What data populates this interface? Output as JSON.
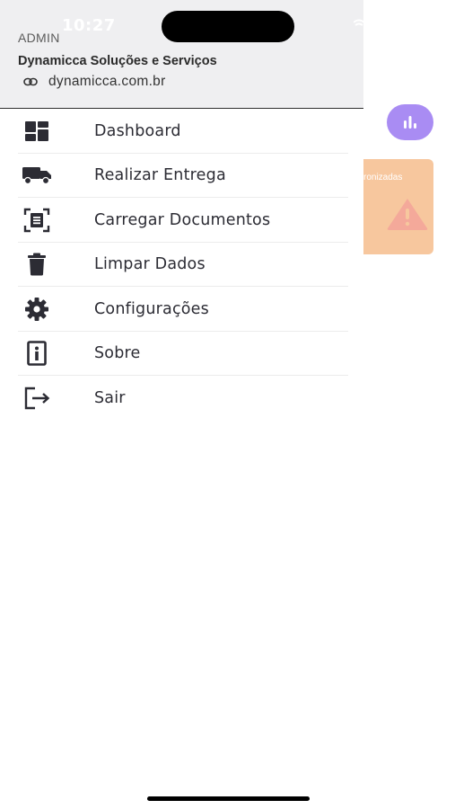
{
  "status_bar": {
    "time": "10:27"
  },
  "drawer": {
    "role": "ADMIN",
    "company": "Dynamicca Soluções e Serviços",
    "website": "dynamicca.com.br",
    "items": [
      {
        "label": "Dashboard",
        "icon": "dashboard-icon"
      },
      {
        "label": "Realizar Entrega",
        "icon": "truck-icon"
      },
      {
        "label": "Carregar Documentos",
        "icon": "document-scan-icon"
      },
      {
        "label": "Limpar Dados",
        "icon": "trash-icon"
      },
      {
        "label": "Configurações",
        "icon": "gear-icon"
      },
      {
        "label": "Sobre",
        "icon": "info-icon"
      },
      {
        "label": "Sair",
        "icon": "logout-icon"
      }
    ]
  },
  "background": {
    "card_text": "ronizadas",
    "fab_icon": "bar-chart-icon",
    "card_icon": "warning-icon",
    "colors": {
      "fab": "#a98cf3",
      "card": "#f7c79e"
    }
  }
}
